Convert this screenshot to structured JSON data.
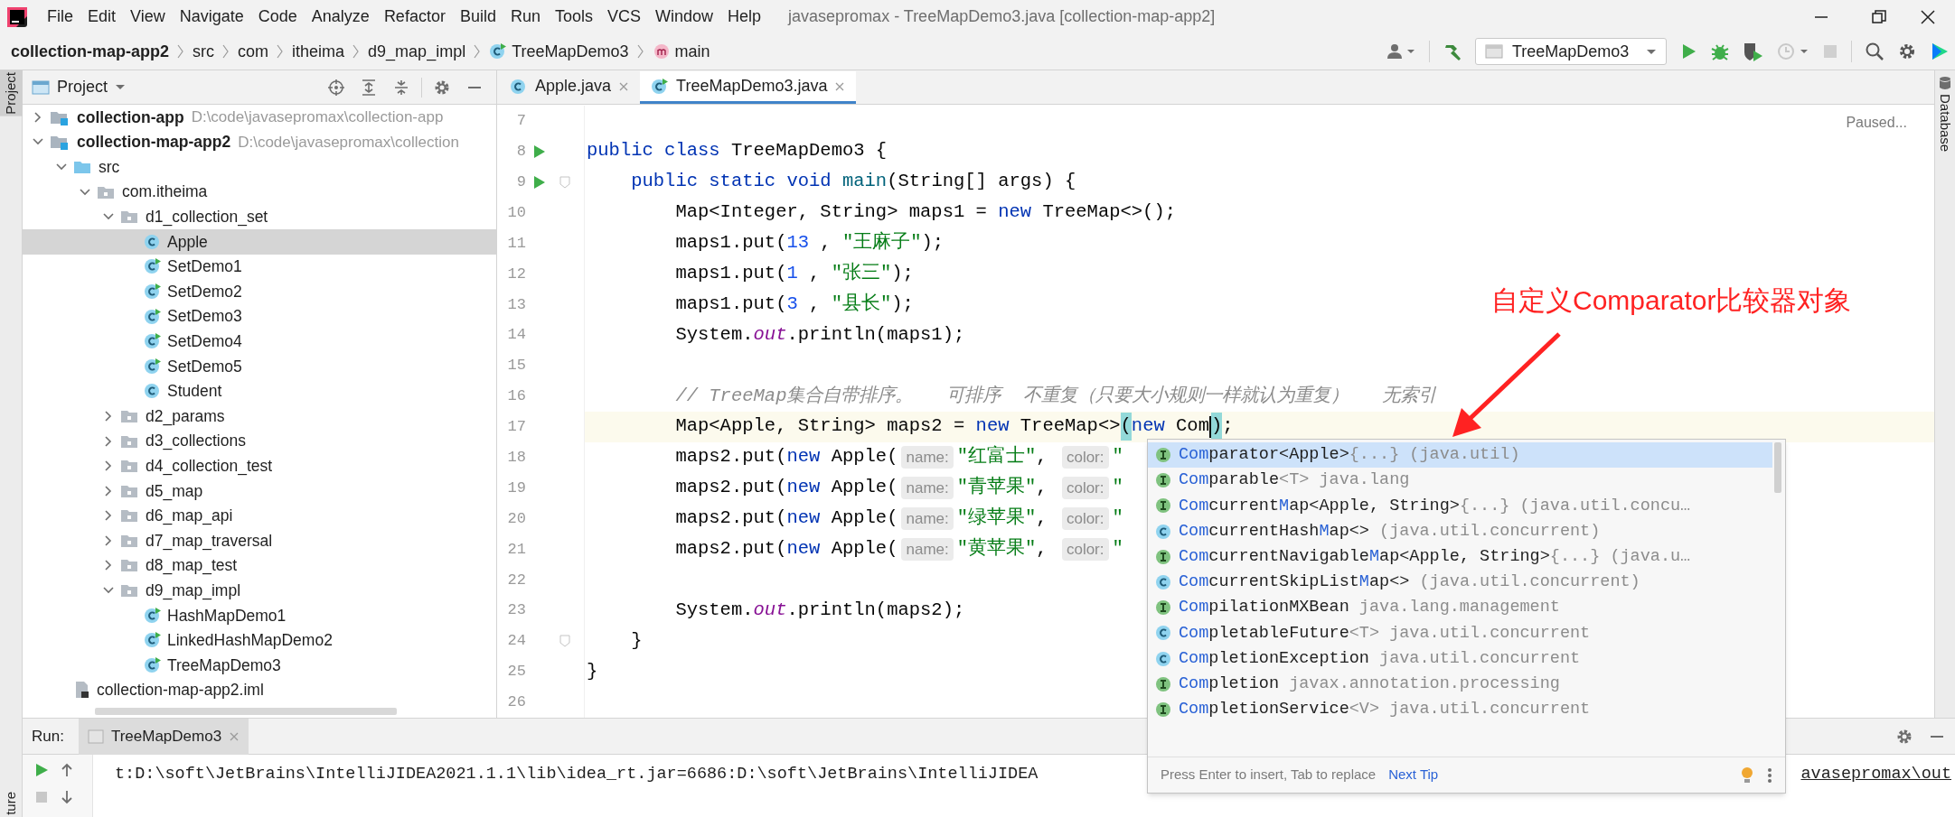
{
  "window": {
    "title": "javasepromax - TreeMapDemo3.java [collection-map-app2]"
  },
  "menu": [
    "File",
    "Edit",
    "View",
    "Navigate",
    "Code",
    "Analyze",
    "Refactor",
    "Build",
    "Run",
    "Tools",
    "VCS",
    "Window",
    "Help"
  ],
  "breadcrumbs": [
    {
      "text": "collection-map-app2",
      "kind": "project"
    },
    {
      "text": "src",
      "kind": "plain"
    },
    {
      "text": "com",
      "kind": "plain"
    },
    {
      "text": "itheima",
      "kind": "plain"
    },
    {
      "text": "d9_map_impl",
      "kind": "plain"
    },
    {
      "text": "TreeMapDemo3",
      "kind": "class"
    },
    {
      "text": "main",
      "kind": "method"
    }
  ],
  "toolbar": {
    "run_config": "TreeMapDemo3"
  },
  "left_stripe": [
    {
      "label": "Project",
      "selected": true
    },
    {
      "label": "ture",
      "selected": false
    }
  ],
  "right_stripe": [
    {
      "label": "Database"
    }
  ],
  "project_panel": {
    "title": "Project",
    "tree": [
      {
        "name": "collection-app",
        "kind": "module",
        "path": "D:\\code\\javasepromax\\collection-app",
        "expanded": false,
        "selected": false
      },
      {
        "name": "collection-map-app2",
        "kind": "module",
        "path": "D:\\code\\javasepromax\\collection",
        "expanded": true,
        "selected": false,
        "children": [
          {
            "name": "src",
            "kind": "source",
            "expanded": true,
            "selected": false,
            "children": [
              {
                "name": "com.itheima",
                "kind": "package",
                "expanded": true,
                "selected": false,
                "children": [
                  {
                    "name": "d1_collection_set",
                    "kind": "package",
                    "expanded": true,
                    "selected": false,
                    "children": [
                      {
                        "name": "Apple",
                        "kind": "class",
                        "selected": true
                      },
                      {
                        "name": "SetDemo1",
                        "kind": "runnable",
                        "selected": false
                      },
                      {
                        "name": "SetDemo2",
                        "kind": "runnable",
                        "selected": false
                      },
                      {
                        "name": "SetDemo3",
                        "kind": "runnable",
                        "selected": false
                      },
                      {
                        "name": "SetDemo4",
                        "kind": "runnable",
                        "selected": false
                      },
                      {
                        "name": "SetDemo5",
                        "kind": "runnable",
                        "selected": false
                      },
                      {
                        "name": "Student",
                        "kind": "class",
                        "selected": false
                      }
                    ]
                  },
                  {
                    "name": "d2_params",
                    "kind": "package",
                    "expanded": false,
                    "selected": false
                  },
                  {
                    "name": "d3_collections",
                    "kind": "package",
                    "expanded": false,
                    "selected": false
                  },
                  {
                    "name": "d4_collection_test",
                    "kind": "package",
                    "expanded": false,
                    "selected": false
                  },
                  {
                    "name": "d5_map",
                    "kind": "package",
                    "expanded": false,
                    "selected": false
                  },
                  {
                    "name": "d6_map_api",
                    "kind": "package",
                    "expanded": false,
                    "selected": false
                  },
                  {
                    "name": "d7_map_traversal",
                    "kind": "package",
                    "expanded": false,
                    "selected": false
                  },
                  {
                    "name": "d8_map_test",
                    "kind": "package",
                    "expanded": false,
                    "selected": false
                  },
                  {
                    "name": "d9_map_impl",
                    "kind": "package",
                    "expanded": true,
                    "selected": false,
                    "children": [
                      {
                        "name": "HashMapDemo1",
                        "kind": "runnable",
                        "selected": false
                      },
                      {
                        "name": "LinkedHashMapDemo2",
                        "kind": "runnable",
                        "selected": false
                      },
                      {
                        "name": "TreeMapDemo3",
                        "kind": "runnable",
                        "selected": false
                      }
                    ]
                  }
                ]
              }
            ]
          },
          {
            "name": "collection-map-app2.iml",
            "kind": "file",
            "selected": false
          }
        ]
      }
    ]
  },
  "editor": {
    "tabs": [
      {
        "label": "Apple.java",
        "selected": false
      },
      {
        "label": "TreeMapDemo3.java",
        "selected": true
      }
    ],
    "status": "Paused...",
    "lines": [
      {
        "number": "7"
      },
      {
        "number": "8",
        "run": true,
        "tokens": [
          {
            "kind": "keyword",
            "text": "public class"
          },
          {
            "kind": "plain",
            "text": " TreeMapDemo3 {"
          }
        ]
      },
      {
        "number": "9",
        "run": true,
        "fold": true,
        "tokens": [
          {
            "kind": "keyword",
            "text": "    public static void"
          },
          {
            "kind": "method",
            "text": " main"
          },
          {
            "kind": "plain",
            "text": "(String[] args) {"
          }
        ]
      },
      {
        "number": "10",
        "tokens": [
          {
            "kind": "plain",
            "text": "        Map<Integer, String> maps1 = "
          },
          {
            "kind": "keyword",
            "text": "new"
          },
          {
            "kind": "plain",
            "text": " TreeMap<>();"
          }
        ]
      },
      {
        "number": "11",
        "tokens": [
          {
            "kind": "plain",
            "text": "        maps1.put("
          },
          {
            "kind": "number",
            "text": "13"
          },
          {
            "kind": "plain",
            "text": " , "
          },
          {
            "kind": "string",
            "text": "\"王麻子\""
          },
          {
            "kind": "plain",
            "text": ");"
          }
        ]
      },
      {
        "number": "12",
        "tokens": [
          {
            "kind": "plain",
            "text": "        maps1.put("
          },
          {
            "kind": "number",
            "text": "1"
          },
          {
            "kind": "plain",
            "text": " , "
          },
          {
            "kind": "string",
            "text": "\"张三\""
          },
          {
            "kind": "plain",
            "text": ");"
          }
        ]
      },
      {
        "number": "13",
        "tokens": [
          {
            "kind": "plain",
            "text": "        maps1.put("
          },
          {
            "kind": "number",
            "text": "3"
          },
          {
            "kind": "plain",
            "text": " , "
          },
          {
            "kind": "string",
            "text": "\"县长\""
          },
          {
            "kind": "plain",
            "text": ");"
          }
        ]
      },
      {
        "number": "14",
        "tokens": [
          {
            "kind": "plain",
            "text": "        System."
          },
          {
            "kind": "field",
            "text": "out"
          },
          {
            "kind": "plain",
            "text": ".println(maps1);"
          }
        ]
      },
      {
        "number": "15"
      },
      {
        "number": "16",
        "tokens": [
          {
            "kind": "comment",
            "text": "        // TreeMap集合自带排序。   可排序  不重复（只要大小规则一样就认为重复）   无索引"
          }
        ]
      },
      {
        "number": "17",
        "current": true,
        "tokens": [
          {
            "kind": "plain",
            "text": "        Map<Apple, String> maps2 = "
          },
          {
            "kind": "keyword",
            "text": "new"
          },
          {
            "kind": "plain",
            "text": " TreeMap<>"
          },
          {
            "kind": "match",
            "text": "("
          },
          {
            "kind": "keyword",
            "text": "new"
          },
          {
            "kind": "plain",
            "text": " Com"
          },
          {
            "kind": "match",
            "text": ")",
            "caret_before": true
          },
          {
            "kind": "plain",
            "text": ";"
          }
        ]
      },
      {
        "number": "18",
        "tokens": [
          {
            "kind": "plain",
            "text": "        maps2.put("
          },
          {
            "kind": "keyword",
            "text": "new"
          },
          {
            "kind": "plain",
            "text": " Apple("
          },
          {
            "kind": "hint",
            "text": "name:"
          },
          {
            "kind": "string",
            "text": "\"红富士\""
          },
          {
            "kind": "plain",
            "text": ", "
          },
          {
            "kind": "hint",
            "text": "color:"
          },
          {
            "kind": "string",
            "text": "\""
          }
        ]
      },
      {
        "number": "19",
        "tokens": [
          {
            "kind": "plain",
            "text": "        maps2.put("
          },
          {
            "kind": "keyword",
            "text": "new"
          },
          {
            "kind": "plain",
            "text": " Apple("
          },
          {
            "kind": "hint",
            "text": "name:"
          },
          {
            "kind": "string",
            "text": "\"青苹果\""
          },
          {
            "kind": "plain",
            "text": ", "
          },
          {
            "kind": "hint",
            "text": "color:"
          },
          {
            "kind": "string",
            "text": "\""
          }
        ]
      },
      {
        "number": "20",
        "tokens": [
          {
            "kind": "plain",
            "text": "        maps2.put("
          },
          {
            "kind": "keyword",
            "text": "new"
          },
          {
            "kind": "plain",
            "text": " Apple("
          },
          {
            "kind": "hint",
            "text": "name:"
          },
          {
            "kind": "string",
            "text": "\"绿苹果\""
          },
          {
            "kind": "plain",
            "text": ", "
          },
          {
            "kind": "hint",
            "text": "color:"
          },
          {
            "kind": "string",
            "text": "\""
          }
        ]
      },
      {
        "number": "21",
        "tokens": [
          {
            "kind": "plain",
            "text": "        maps2.put("
          },
          {
            "kind": "keyword",
            "text": "new"
          },
          {
            "kind": "plain",
            "text": " Apple("
          },
          {
            "kind": "hint",
            "text": "name:"
          },
          {
            "kind": "string",
            "text": "\"黄苹果\""
          },
          {
            "kind": "plain",
            "text": ", "
          },
          {
            "kind": "hint",
            "text": "color:"
          },
          {
            "kind": "string",
            "text": "\""
          }
        ]
      },
      {
        "number": "22"
      },
      {
        "number": "23",
        "tokens": [
          {
            "kind": "plain",
            "text": "        System."
          },
          {
            "kind": "field",
            "text": "out"
          },
          {
            "kind": "plain",
            "text": ".println(maps2);"
          }
        ]
      },
      {
        "number": "24",
        "fold": true,
        "tokens": [
          {
            "kind": "plain",
            "text": "    }"
          }
        ]
      },
      {
        "number": "25",
        "tokens": [
          {
            "kind": "plain",
            "text": "}"
          }
        ]
      },
      {
        "number": "26"
      }
    ]
  },
  "completion": {
    "items": [
      {
        "kind": "interface",
        "selected": true,
        "parts": [
          {
            "kind": "match",
            "text": "Com"
          },
          {
            "kind": "name",
            "text": "parator<Apple>"
          },
          {
            "kind": "grey",
            "text": "{...} (java.util)"
          }
        ]
      },
      {
        "kind": "interface",
        "selected": false,
        "parts": [
          {
            "kind": "match",
            "text": "Com"
          },
          {
            "kind": "name",
            "text": "parable"
          },
          {
            "kind": "grey",
            "text": "<T> java.lang"
          }
        ]
      },
      {
        "kind": "interface",
        "selected": false,
        "parts": [
          {
            "kind": "match",
            "text": "Com"
          },
          {
            "kind": "name",
            "text": "current"
          },
          {
            "kind": "match",
            "text": "M"
          },
          {
            "kind": "name",
            "text": "ap<Apple, String>"
          },
          {
            "kind": "grey",
            "text": "{...} (java.util.concu…"
          }
        ]
      },
      {
        "kind": "class",
        "selected": false,
        "parts": [
          {
            "kind": "match",
            "text": "Com"
          },
          {
            "kind": "name",
            "text": "currentHash"
          },
          {
            "kind": "match",
            "text": "M"
          },
          {
            "kind": "name",
            "text": "ap<>"
          },
          {
            "kind": "grey",
            "text": " (java.util.concurrent)"
          }
        ]
      },
      {
        "kind": "interface",
        "selected": false,
        "parts": [
          {
            "kind": "match",
            "text": "Com"
          },
          {
            "kind": "name",
            "text": "currentNavigable"
          },
          {
            "kind": "match",
            "text": "M"
          },
          {
            "kind": "name",
            "text": "ap<Apple, String>"
          },
          {
            "kind": "grey",
            "text": "{...} (java.u…"
          }
        ]
      },
      {
        "kind": "class",
        "selected": false,
        "parts": [
          {
            "kind": "match",
            "text": "Com"
          },
          {
            "kind": "name",
            "text": "currentSkipList"
          },
          {
            "kind": "match",
            "text": "M"
          },
          {
            "kind": "name",
            "text": "ap<>"
          },
          {
            "kind": "grey",
            "text": " (java.util.concurrent)"
          }
        ]
      },
      {
        "kind": "interface",
        "selected": false,
        "parts": [
          {
            "kind": "match",
            "text": "Com"
          },
          {
            "kind": "name",
            "text": "pilationMXBean"
          },
          {
            "kind": "grey",
            "text": " java.lang.management"
          }
        ]
      },
      {
        "kind": "class",
        "selected": false,
        "parts": [
          {
            "kind": "match",
            "text": "Com"
          },
          {
            "kind": "name",
            "text": "pletableFuture"
          },
          {
            "kind": "grey",
            "text": "<T> java.util.concurrent"
          }
        ]
      },
      {
        "kind": "class",
        "selected": false,
        "parts": [
          {
            "kind": "match",
            "text": "Com"
          },
          {
            "kind": "name",
            "text": "pletionException"
          },
          {
            "kind": "grey",
            "text": " java.util.concurrent"
          }
        ]
      },
      {
        "kind": "interface",
        "selected": false,
        "parts": [
          {
            "kind": "match",
            "text": "Com"
          },
          {
            "kind": "name",
            "text": "pletion"
          },
          {
            "kind": "grey",
            "text": " javax.annotation.processing"
          }
        ]
      },
      {
        "kind": "interface",
        "selected": false,
        "parts": [
          {
            "kind": "match",
            "text": "Com"
          },
          {
            "kind": "name",
            "text": "pletionService"
          },
          {
            "kind": "grey",
            "text": "<V> java.util.concurrent"
          }
        ]
      }
    ],
    "footer": "Press Enter to insert, Tab to replace",
    "tip_link": "Next Tip"
  },
  "annotation": {
    "text": "自定义Comparator比较器对象"
  },
  "run_panel": {
    "label": "Run:",
    "tabs": [
      {
        "label": "TreeMapDemo3",
        "selected": true
      }
    ],
    "console": [
      "t:D:\\soft\\JetBrains\\IntelliJIDEA2021.1.1\\lib\\idea_rt.jar=6686:D:\\soft\\JetBrains\\IntelliJIDEA",
      "avasepromax\\out"
    ]
  }
}
